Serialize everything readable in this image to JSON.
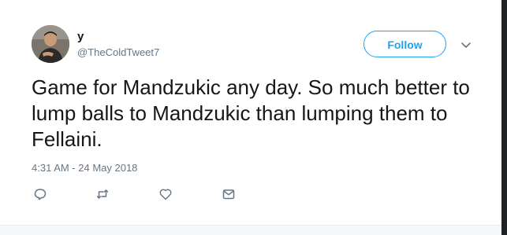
{
  "tweet": {
    "author": {
      "name": "y",
      "handle": "@TheColdTweet7",
      "avatar_icon": "user-avatar"
    },
    "follow_label": "Follow",
    "more_icon": "chevron-down-icon",
    "text": "Game for Mandzukic any day. So much better to lump balls to Mandzukic than lumping them to Fellaini.",
    "timestamp": "4:31 AM - 24 May 2018",
    "actions": [
      {
        "icon": "reply-icon"
      },
      {
        "icon": "retweet-icon"
      },
      {
        "icon": "like-icon"
      },
      {
        "icon": "direct-message-icon"
      }
    ]
  },
  "colors": {
    "accent": "#1da1f2",
    "text": "#14171a",
    "secondary_text": "#657786"
  }
}
